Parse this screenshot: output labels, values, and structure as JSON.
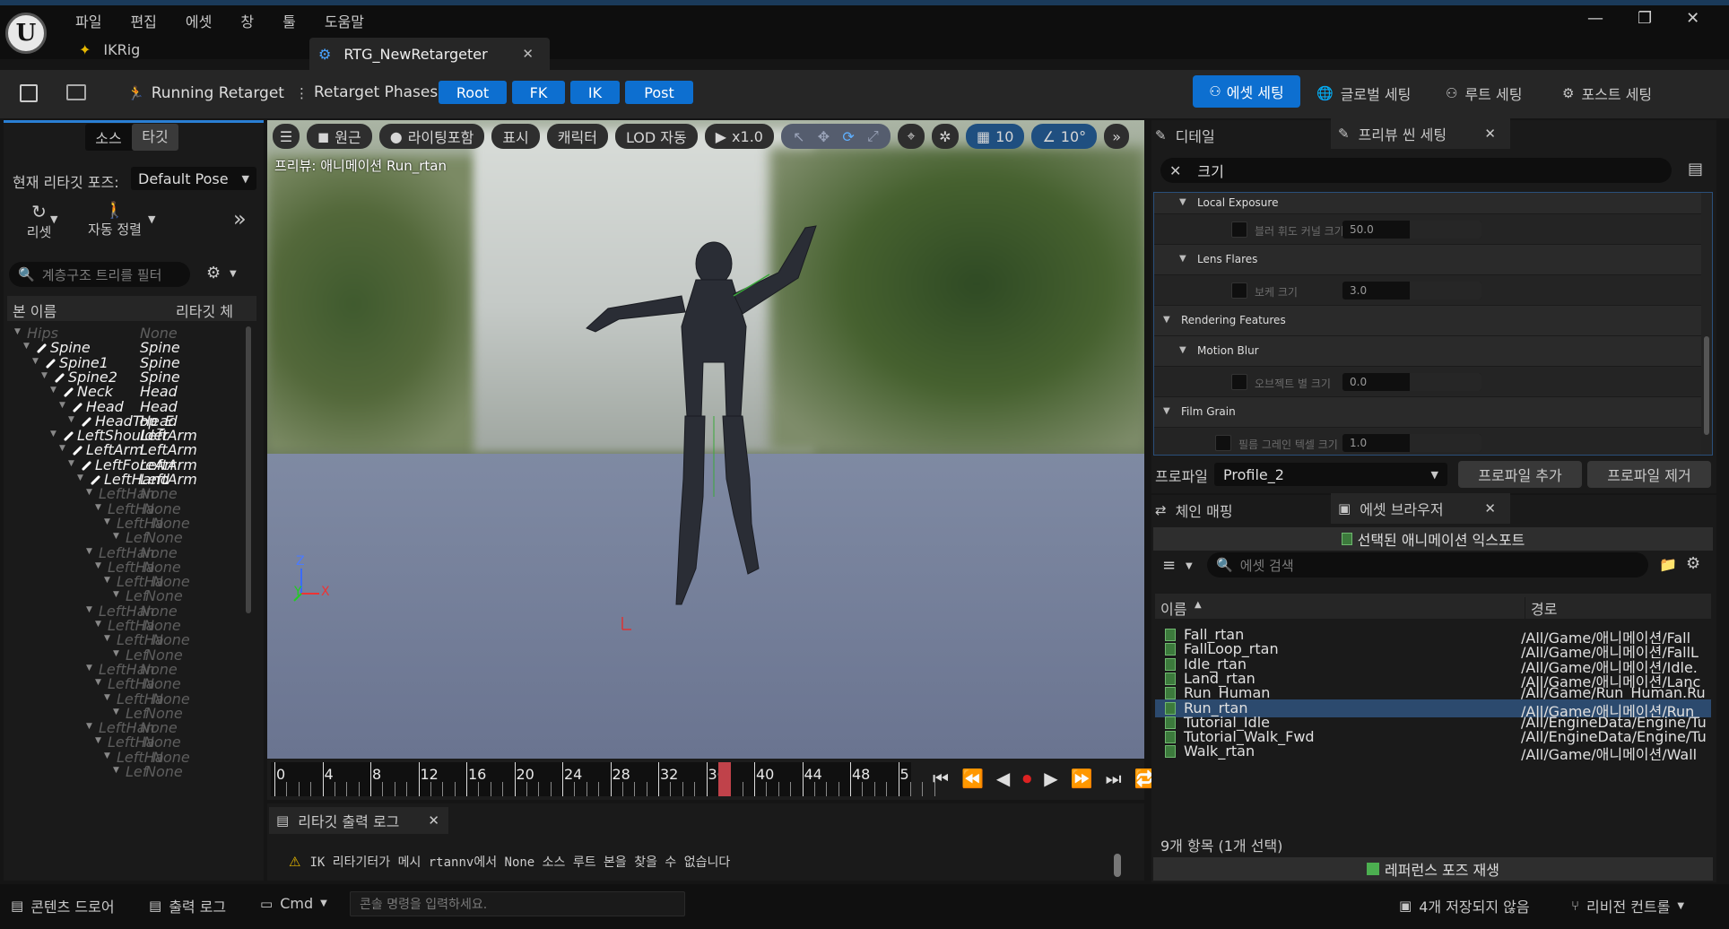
{
  "menu": {
    "items": [
      "파일",
      "편집",
      "에셋",
      "창",
      "툴",
      "도움말"
    ]
  },
  "tabs": {
    "ikrig": "IKRig",
    "retargeter": "RTG_NewRetargeter"
  },
  "toolbar": {
    "running_retarget": "Running Retarget",
    "phases_label": "Retarget Phases:",
    "phases": [
      "Root",
      "FK",
      "IK",
      "Post"
    ],
    "asset_settings": "에셋 세팅",
    "global_settings": "글로벌 세팅",
    "root_settings": "루트 세팅",
    "post_settings": "포스트 세팅"
  },
  "left_panel": {
    "tab_source": "소스",
    "tab_target": "타깃",
    "pose_label": "현재 리타깃 포즈:",
    "pose_value": "Default Pose",
    "reset_label": "리셋",
    "auto_align_label": "자동 정렬",
    "search_placeholder": "계층구조 트리를 필터",
    "col_bone": "본 이름",
    "col_chain": "리타깃 체",
    "bones": [
      {
        "name": "Hips",
        "chain": "None",
        "dim": true
      },
      {
        "name": "Spine",
        "chain": "Spine",
        "dim": false
      },
      {
        "name": "Spine1",
        "chain": "Spine",
        "dim": false
      },
      {
        "name": "Spine2",
        "chain": "Spine",
        "dim": false
      },
      {
        "name": "Neck",
        "chain": "Head",
        "dim": false
      },
      {
        "name": "Head",
        "chain": "Head",
        "dim": false
      },
      {
        "name": "HeadTop_E",
        "chain": "Head",
        "dim": false
      },
      {
        "name": "LeftShoulder",
        "chain": "LeftArm",
        "dim": false
      },
      {
        "name": "LeftArm",
        "chain": "LeftArm",
        "dim": false
      },
      {
        "name": "LeftForeArr",
        "chain": "LeftArm",
        "dim": false
      },
      {
        "name": "LeftHand",
        "chain": "LeftArm",
        "dim": false
      },
      {
        "name": "LeftHan",
        "chain": "None",
        "dim": true
      },
      {
        "name": "LeftHa",
        "chain": "None",
        "dim": true
      },
      {
        "name": "LeftHa",
        "chain": "None",
        "dim": true
      },
      {
        "name": "Lef",
        "chain": "None",
        "dim": true
      },
      {
        "name": "LeftHan",
        "chain": "None",
        "dim": true
      },
      {
        "name": "LeftHa",
        "chain": "None",
        "dim": true
      },
      {
        "name": "LeftHa",
        "chain": "None",
        "dim": true
      },
      {
        "name": "Lef",
        "chain": "None",
        "dim": true
      },
      {
        "name": "LeftHan",
        "chain": "None",
        "dim": true
      },
      {
        "name": "LeftHa",
        "chain": "None",
        "dim": true
      },
      {
        "name": "LeftHa",
        "chain": "None",
        "dim": true
      },
      {
        "name": "Lef",
        "chain": "None",
        "dim": true
      },
      {
        "name": "LeftHan",
        "chain": "None",
        "dim": true
      },
      {
        "name": "LeftHa",
        "chain": "None",
        "dim": true
      },
      {
        "name": "LeftHa",
        "chain": "None",
        "dim": true
      },
      {
        "name": "Lef",
        "chain": "None",
        "dim": true
      },
      {
        "name": "LeftHan",
        "chain": "None",
        "dim": true
      },
      {
        "name": "LeftHa",
        "chain": "None",
        "dim": true
      },
      {
        "name": "LeftHa",
        "chain": "None",
        "dim": true
      },
      {
        "name": "Lef",
        "chain": "None",
        "dim": true
      }
    ]
  },
  "viewport": {
    "perspective": "원근",
    "lighting": "라이팅포함",
    "show": "표시",
    "character": "캐릭터",
    "lod": "LOD 자동",
    "play_rate": "x1.0",
    "grid_snap": "10",
    "angle_snap": "10°",
    "preview_label": "프리뷰: 애니메이션 Run_rtan",
    "axis_z": "Z",
    "axis_y": "Y",
    "axis_x": "X"
  },
  "timeline": {
    "ticks": [
      "0",
      "4",
      "8",
      "12",
      "16",
      "20",
      "24",
      "28",
      "32",
      "36",
      "40",
      "44",
      "48",
      "5"
    ],
    "playhead_frame": 37
  },
  "output_log": {
    "tab": "리타깃 출력 로그",
    "message": "IK 리타기터가 메시 rtannv에서 None 소스 루트 본을 찾을 수 없습니다"
  },
  "details": {
    "tab_details": "디테일",
    "tab_preview_scene": "프리뷰 씬 세팅",
    "search_value": "크기",
    "groups": [
      {
        "label": "Local Exposure",
        "level": 1
      },
      {
        "label": "블러 휘도 커널 크기 퍼센트",
        "level": 2,
        "value": "50.0"
      },
      {
        "label": "Lens Flares",
        "level": 1
      },
      {
        "label": "보케 크기",
        "level": 2,
        "value": "3.0"
      },
      {
        "label": "Rendering Features",
        "level": 0
      },
      {
        "label": "Motion Blur",
        "level": 1
      },
      {
        "label": "오브젝트 별 크기",
        "level": 2,
        "value": "0.0"
      },
      {
        "label": "Film Grain",
        "level": 0
      },
      {
        "label": "필름 그레인 텍셀 크기",
        "level": 1,
        "value": "1.0"
      }
    ],
    "profile_label": "프로파일",
    "profile_value": "Profile_2",
    "add_profile": "프로파일 추가",
    "remove_profile": "프로파일 제거"
  },
  "asset_browser": {
    "tab_chain": "체인 매핑",
    "tab_assets": "에셋 브라우저",
    "export_button": "선택된 애니메이션 익스포트",
    "search_placeholder": "에셋 검색",
    "col_name": "이름",
    "col_path": "경로",
    "items": [
      {
        "name": "Fall_rtan",
        "path": "/All/Game/애니메이션/Fall_"
      },
      {
        "name": "FallLoop_rtan",
        "path": "/All/Game/애니메이션/FallL"
      },
      {
        "name": "Idle_rtan",
        "path": "/All/Game/애니메이션/Idle."
      },
      {
        "name": "Land_rtan",
        "path": "/All/Game/애니메이션/Lanc"
      },
      {
        "name": "Run_Human",
        "path": "/All/Game/Run_Human.Ru"
      },
      {
        "name": "Run_rtan",
        "path": "/All/Game/애니메이션/Run"
      },
      {
        "name": "Tutorial_Idle",
        "path": "/All/EngineData/Engine/Tu"
      },
      {
        "name": "Tutorial_Walk_Fwd",
        "path": "/All/EngineData/Engine/Tu"
      },
      {
        "name": "Walk_rtan",
        "path": "/All/Game/애니메이션/Wall"
      }
    ],
    "selected_index": 5,
    "count_text": "9개 항목 (1개 선택)",
    "ref_pose_button": "레퍼런스 포즈 재생"
  },
  "statusbar": {
    "content_drawer": "콘텐츠 드로어",
    "output_log": "출력 로그",
    "cmd": "Cmd",
    "console_placeholder": "콘솔 명령을 입력하세요.",
    "unsaved": "4개 저장되지 않음",
    "revision_control": "리비전 컨트롤"
  }
}
